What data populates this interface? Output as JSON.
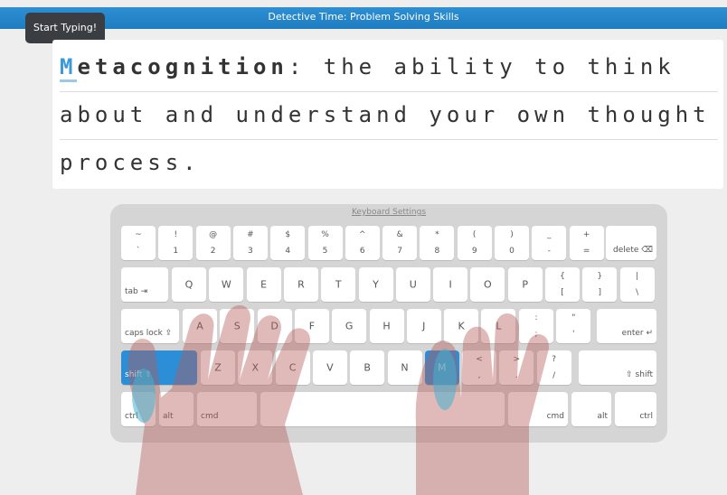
{
  "title": "Detective Time: Problem Solving Skills",
  "tooltip": "Start Typing!",
  "passage": {
    "line1_cursor": "M",
    "line1_bold": "etacognition",
    "line1_rest": ": the ability to think",
    "line2": "about and understand your own thought",
    "line3": "process."
  },
  "keyboard": {
    "settings_link": "Keyboard Settings",
    "row1": [
      [
        "~",
        "`"
      ],
      [
        "!",
        "1"
      ],
      [
        "@",
        "2"
      ],
      [
        "#",
        "3"
      ],
      [
        "$",
        "4"
      ],
      [
        "%",
        "5"
      ],
      [
        "^",
        "6"
      ],
      [
        "&",
        "7"
      ],
      [
        "*",
        "8"
      ],
      [
        "(",
        "9"
      ],
      [
        ")",
        "0"
      ],
      [
        "_",
        "-"
      ],
      [
        "+",
        "="
      ]
    ],
    "row1_delete": "delete ⌫",
    "row2_tab": "tab ⇥",
    "row2": [
      "Q",
      "W",
      "E",
      "R",
      "T",
      "Y",
      "U",
      "I",
      "O",
      "P"
    ],
    "row2_punct": [
      [
        "{",
        "["
      ],
      [
        "}",
        "]"
      ],
      [
        "|",
        "\\"
      ]
    ],
    "row3_caps": "caps lock ⇪",
    "row3": [
      "A",
      "S",
      "D",
      "F",
      "G",
      "H",
      "J",
      "K",
      "L"
    ],
    "row3_punct": [
      [
        ":",
        ";"
      ],
      [
        "\"",
        "'"
      ]
    ],
    "row3_enter": "enter ↵",
    "row4_lshift": "shift ⇧",
    "row4": [
      "Z",
      "X",
      "C",
      "V",
      "B",
      "N",
      "M"
    ],
    "row4_punct": [
      [
        "<",
        ","
      ],
      [
        ">",
        "."
      ],
      [
        "?",
        "/"
      ]
    ],
    "row4_rshift": "⇧ shift",
    "row5": {
      "ctrl": "ctrl",
      "alt": "alt",
      "cmd": "cmd",
      "cmd_r": "cmd",
      "alt_r": "alt",
      "ctrl_r": "ctrl"
    },
    "highlight_color": "#2d8ed8"
  }
}
